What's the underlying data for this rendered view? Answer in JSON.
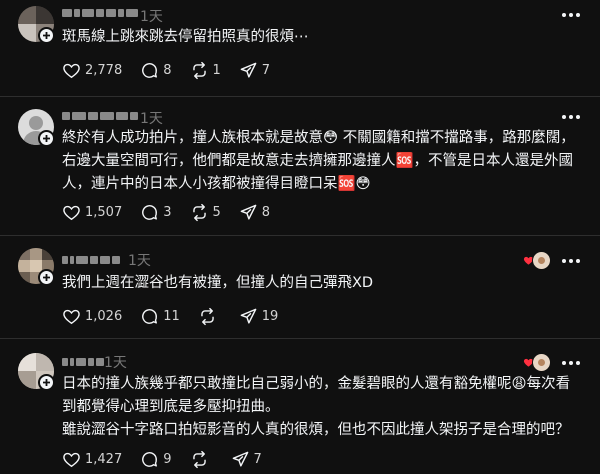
{
  "colors": {
    "background": "#101010",
    "text": "#f3f5f7",
    "muted": "#777777",
    "divider": "#2e2e2e",
    "reaction_heart": "#ff3040"
  },
  "posts": [
    {
      "time": "1天",
      "lines": [
        "斑馬線上跳來跳去停留拍照真的很煩⋯"
      ],
      "likes": "2,778",
      "comments": "8",
      "reposts": "1",
      "shares": "7"
    },
    {
      "time": "1天",
      "lines": [
        "終於有人成功拍片，撞人族根本就是故意😳 不關國籍和擋不擋路事，路那麼闊，右邊大量空間可行，他們都是故意走去擠擁那邊撞人🆘，不管是日本人還是外國人，連片中的日本人小孩都被撞得目瞪口呆🆘😳"
      ],
      "likes": "1,507",
      "comments": "3",
      "reposts": "5",
      "shares": "8"
    },
    {
      "time": "1天",
      "lines": [
        "我們上週在澀谷也有被撞，但撞人的自己彈飛XD"
      ],
      "likes": "1,026",
      "comments": "11",
      "reposts": "",
      "shares": "19"
    },
    {
      "time": "1天",
      "lines": [
        "日本的撞人族幾乎都只敢撞比自己弱小的，金髮碧眼的人還有豁免權呢😩每次看到都覺得心理到底是多壓抑扭曲。",
        "雖說澀谷十字路口拍短影音的人真的很煩，但也不因此撞人架拐子是合理的吧？"
      ],
      "likes": "1,427",
      "comments": "9",
      "reposts": "",
      "shares": "7"
    }
  ]
}
